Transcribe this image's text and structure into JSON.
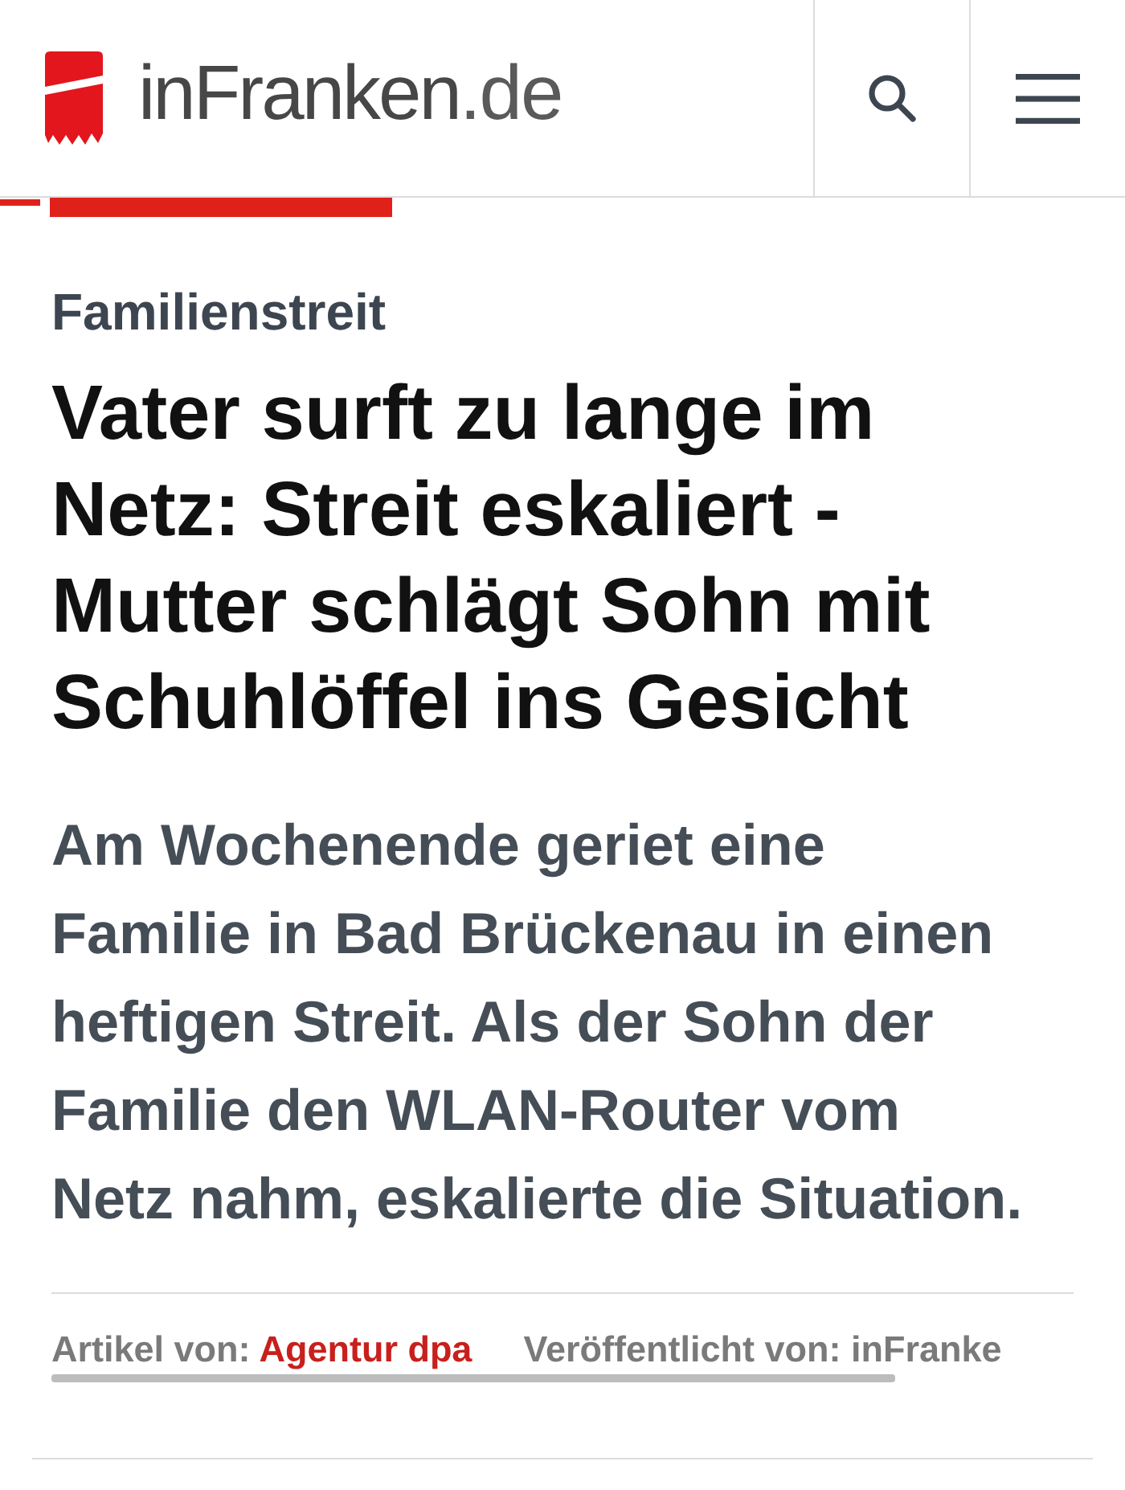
{
  "header": {
    "logo": {
      "name": "inFranken",
      "suffix": ".de"
    }
  },
  "article": {
    "kicker": "Familienstreit",
    "headline": "Vater surft zu lange im Netz: Streit eskaliert - Mutter schlägt Sohn mit Schuhlöffel ins Gesicht",
    "lead": "Am Wochenende geriet eine Familie in Bad Brückenau in einen heftigen Streit. Als der Sohn der Familie den WLAN-Router vom Netz nahm, eskalierte die Situation.",
    "byline": {
      "author_label": "Artikel von:",
      "author": "Agentur dpa",
      "publisher_credit": "Veröffentlicht von: inFranke"
    }
  }
}
